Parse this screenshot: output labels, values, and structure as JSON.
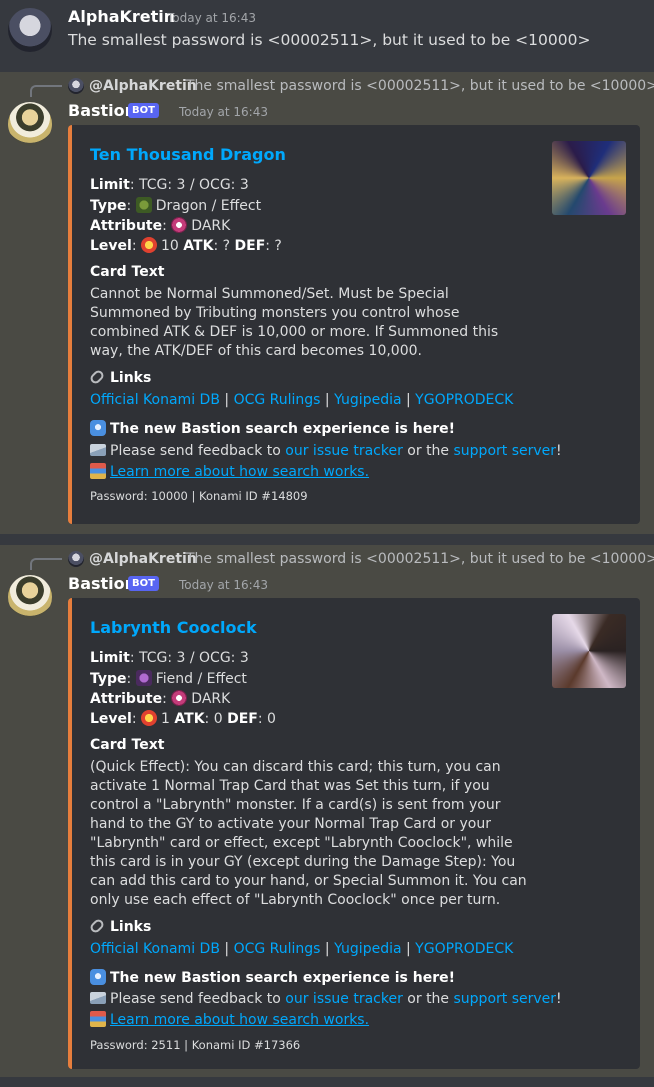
{
  "message1": {
    "username": "AlphaKretin",
    "timestamp": "Today at 16:43",
    "content": "The smallest password is <00002511>, but it used to be <10000>"
  },
  "reply": {
    "name": "@AlphaKretin",
    "text": "The smallest password is <00002511>, but it used to be <10000>"
  },
  "bot": {
    "username": "Bastion",
    "badge": "BOT",
    "timestamp": "Today at 16:43"
  },
  "labels": {
    "limit": "Limit",
    "type": "Type",
    "attribute": "Attribute",
    "level": "Level",
    "atk": "ATK",
    "def": "DEF",
    "card_text": "Card Text",
    "links": "Links",
    "new_search": "The new Bastion search experience is here!",
    "feedback_prefix": "Please send feedback to ",
    "issue_tracker": "our issue tracker",
    "or_the": " or the ",
    "support_server": "support server",
    "bang": "!",
    "learn_more": "Learn more about how search works.",
    "link_official": "Official Konami DB",
    "link_ocg": "OCG Rulings",
    "link_yugipedia": "Yugipedia",
    "link_ygopro": "YGOPRODECK",
    "sep": " | "
  },
  "card1": {
    "title": "Ten Thousand Dragon",
    "limit": ": TCG: 3 / OCG: 3",
    "type": "Dragon / Effect",
    "attribute": "DARK",
    "level": "10",
    "atk": ": ?",
    "def": ": ?",
    "text": "Cannot be Normal Summoned/Set. Must be Special Summoned by Tributing monsters you control whose combined ATK & DEF is 10,000 or more. If Summoned this way, the ATK/DEF of this card becomes 10,000.",
    "footer": "Password: 10000 | Konami ID #14809"
  },
  "card2": {
    "title": "Labrynth Cooclock",
    "limit": ": TCG: 3 / OCG: 3",
    "type": "Fiend / Effect",
    "attribute": "DARK",
    "level": "1",
    "atk": ": 0",
    "def": ": 0",
    "text": "(Quick Effect): You can discard this card; this turn, you can activate 1 Normal Trap Card that was Set this turn, if you control a \"Labrynth\" monster. If a card(s) is sent from your hand to the GY to activate your Normal Trap Card or your \"Labrynth\" card or effect, except \"Labrynth Cooclock\", while this card is in your GY (except during the Damage Step): You can add this card to your hand, or Special Summon it. You can only use each effect of \"Labrynth Cooclock\" once per turn.",
    "footer": "Password: 2511 | Konami ID #17366"
  },
  "colors": {
    "embed_accent": "#e77e3d",
    "link": "#00a8fc",
    "bot_badge": "#5865f2"
  }
}
